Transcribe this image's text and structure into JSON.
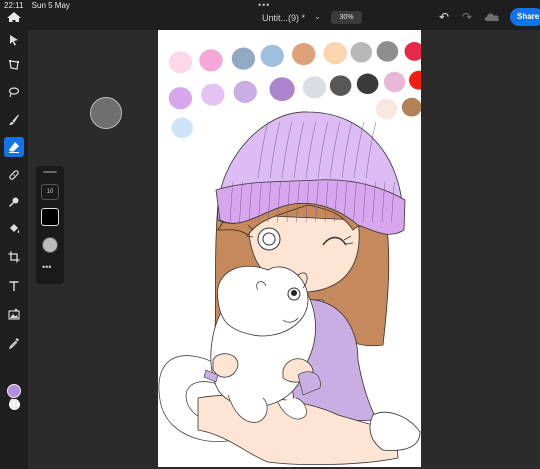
{
  "status": {
    "time": "22:11",
    "date": "Sun 5 May"
  },
  "header": {
    "title": "Untit...(9) *",
    "zoom": "30%",
    "share_label": "Share"
  },
  "brush_panel": {
    "size": "10",
    "more": "•••"
  },
  "colors": {
    "accent": "#1473e6",
    "foreground_swatch": "#b58de0",
    "background_swatch": "#ffffff",
    "palette": [
      "#fcd9e8",
      "#f5a8d8",
      "#93a8c2",
      "#9ec0de",
      "#dea27a",
      "#fcd4ad",
      "#b8b8b8",
      "#8e8e8e",
      "#e6284a",
      "#d7a6ec",
      "#e4c2f2",
      "#c8aee2",
      "#ad85cf",
      "#dadde2",
      "#575757",
      "#3a3a3a",
      "#e8b8d8",
      "#ef2010",
      "#f8e6e0",
      "#b48258",
      "#cde4f7"
    ]
  },
  "toolbar": {
    "tools": [
      "home-icon",
      "select-icon",
      "transform-icon",
      "lasso-icon",
      "brush-icon",
      "eraser-icon",
      "healing-icon",
      "smudge-icon",
      "fill-icon",
      "crop-icon",
      "text-icon",
      "image-icon",
      "eyedropper-icon",
      "swap-icon"
    ],
    "active": "eraser-icon"
  }
}
